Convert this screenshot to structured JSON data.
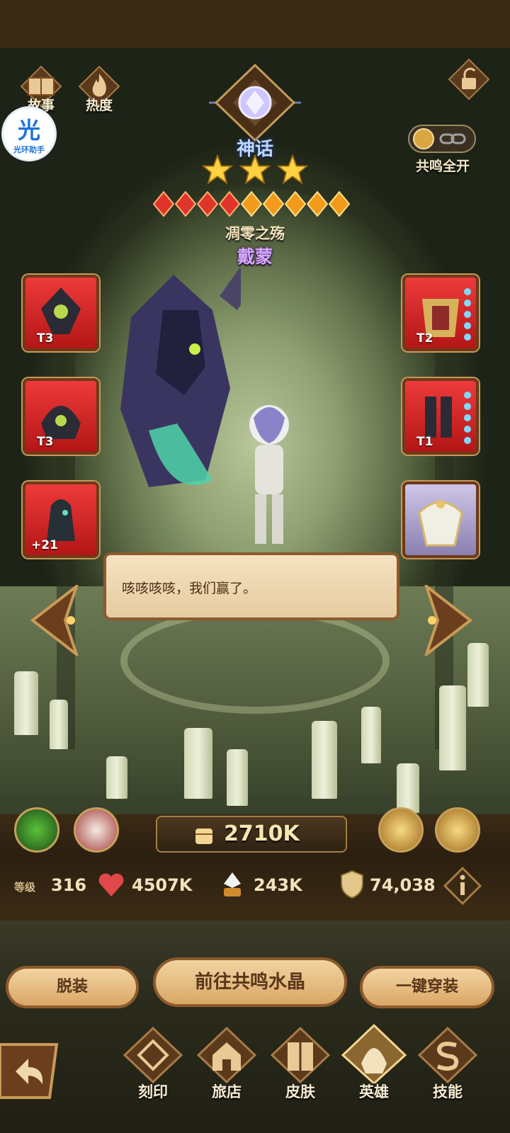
{
  "top": {
    "story_label": "故事",
    "heat_label": "热度",
    "rarity_label": "神话",
    "resonance_label": "共鸣全开"
  },
  "overlay": {
    "app_badge_glyph": "光",
    "app_badge_text": "光环助手"
  },
  "hero": {
    "stars": 3,
    "gems_total": 9,
    "title": "凋零之殇",
    "name": "戴蒙"
  },
  "equipment": {
    "left": [
      {
        "tier": "T3"
      },
      {
        "tier": "T3"
      },
      {
        "level": "+21"
      }
    ],
    "right": [
      {
        "tier": "T2"
      },
      {
        "tier": "T1"
      },
      {
        "tier": ""
      }
    ]
  },
  "dialog": {
    "text": "咳咳咳咳，我们赢了。"
  },
  "power": {
    "value": "2710K"
  },
  "stats": {
    "level_label": "等级",
    "level": "316",
    "hp": "4507K",
    "attack": "243K",
    "defense": "74,038"
  },
  "actions": {
    "unequip": "脱装",
    "goto_crystal": "前往共鸣水晶",
    "auto_equip": "一键穿装"
  },
  "tabs": [
    {
      "label": "刻印"
    },
    {
      "label": "旅店"
    },
    {
      "label": "皮肤"
    },
    {
      "label": "英雄"
    },
    {
      "label": "技能"
    }
  ],
  "colors": {
    "accent_gold": "#c8a05a",
    "mythic_blue": "#bfd8ff",
    "name_purple": "#d7a8ff",
    "slot_red": "#e02a2a"
  }
}
